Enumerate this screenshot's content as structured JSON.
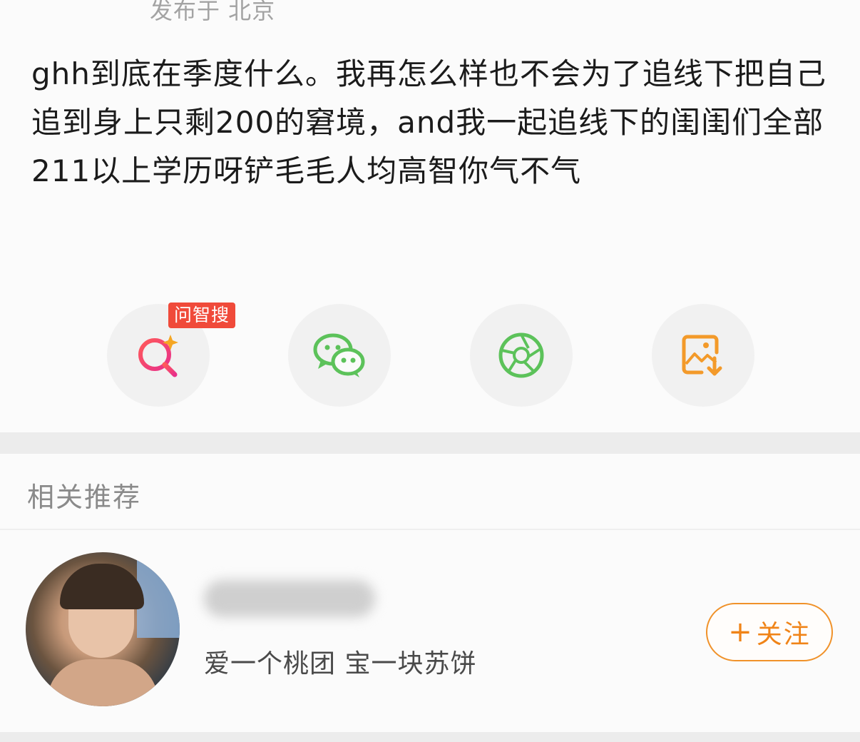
{
  "post": {
    "meta": "发布于 北京",
    "text": "ghh到底在季度什么。我再怎么样也不会为了追线下把自己追到身上只剩200的窘境，and我一起追线下的闺闺们全部211以上学历呀铲毛毛人均高智你气不气"
  },
  "share": {
    "badge": "问智搜",
    "buttons": [
      {
        "icon": "ai-search-icon",
        "color": "#ef3f3f"
      },
      {
        "icon": "wechat-icon",
        "color": "#5cc25a"
      },
      {
        "icon": "moments-icon",
        "color": "#5cc25a"
      },
      {
        "icon": "save-image-icon",
        "color": "#f39a2a"
      }
    ]
  },
  "related": {
    "title": "相关推荐",
    "user": {
      "bio": "爱一个桃团 宝一块苏饼",
      "follow_label": "关注",
      "follow_plus": "+"
    }
  },
  "colors": {
    "accent_orange": "#f08418",
    "badge_red": "#f04a3a",
    "wechat_green": "#5cc25a"
  }
}
